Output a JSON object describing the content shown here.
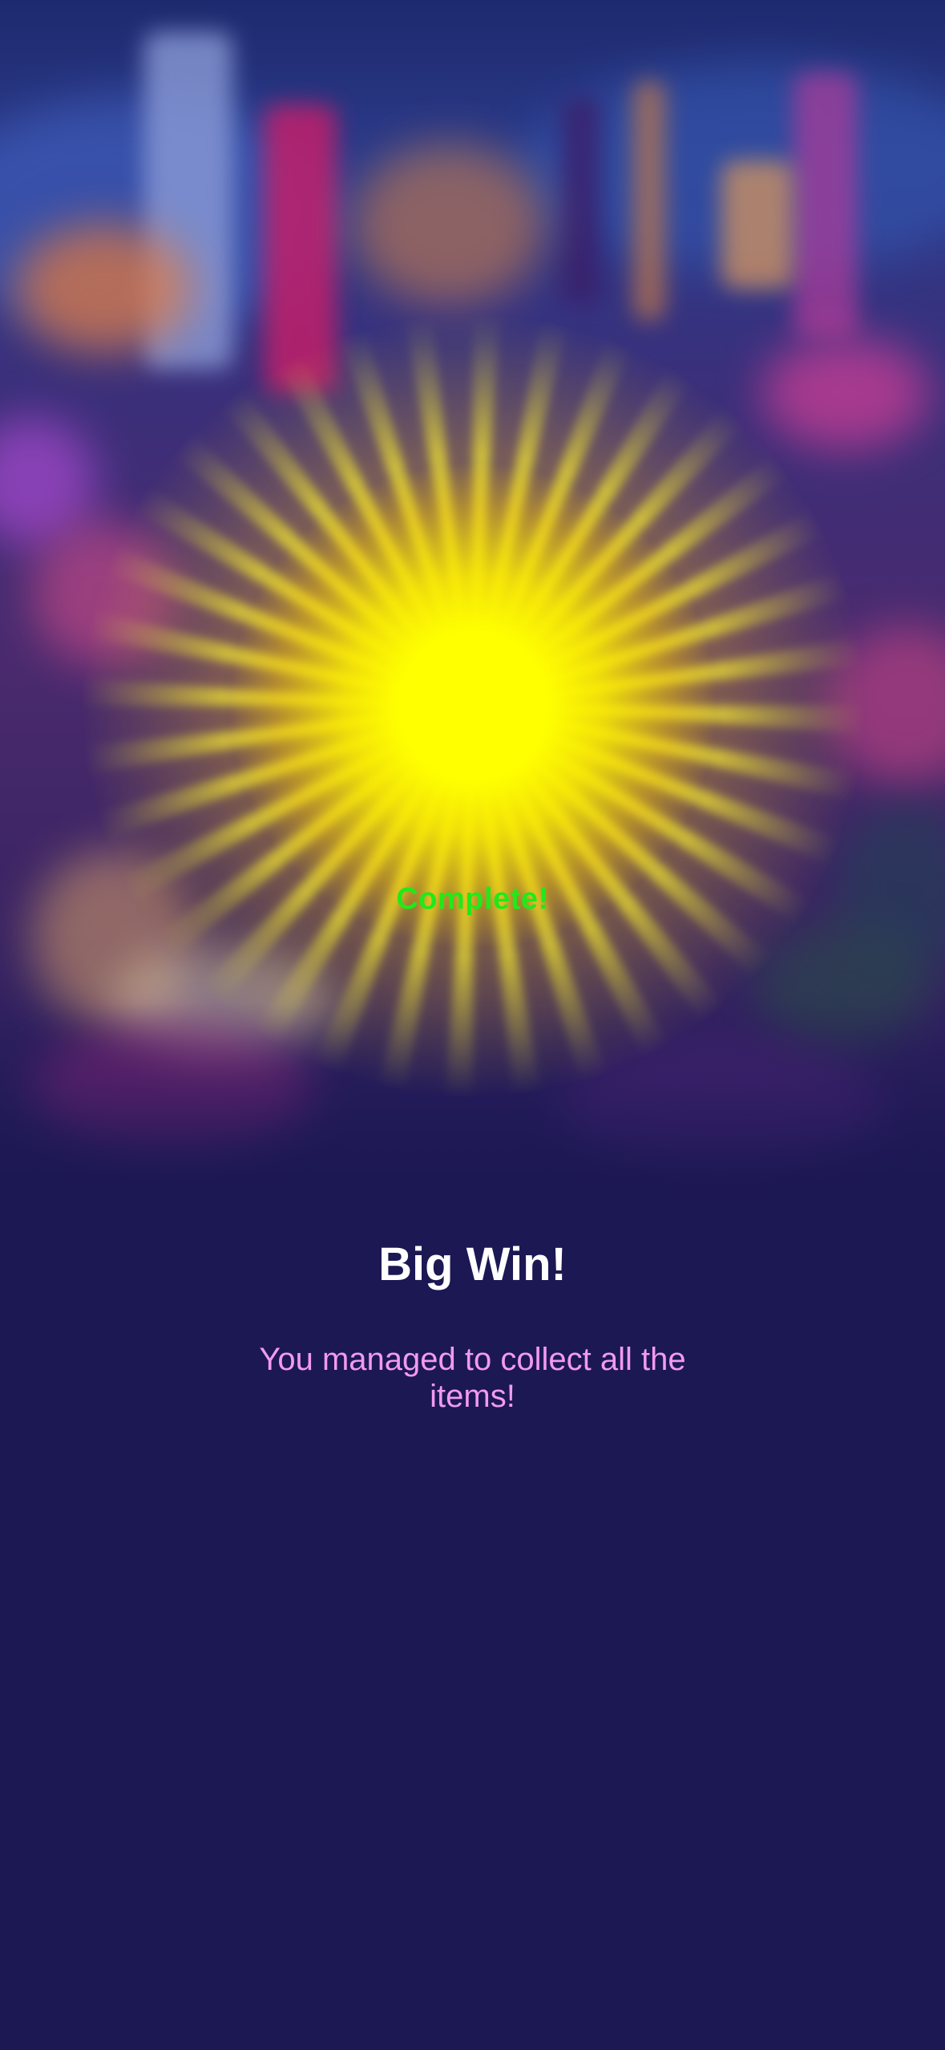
{
  "result": {
    "status_label": "Complete!",
    "title": "Big Win!",
    "message": "You managed to collect all the items!"
  },
  "colors": {
    "background": "#1b1853",
    "status": "#22e81a",
    "title": "#ffffff",
    "message": "#f29af0",
    "burst": "#ffff00"
  },
  "icons": {
    "burst": "sunburst-icon"
  }
}
